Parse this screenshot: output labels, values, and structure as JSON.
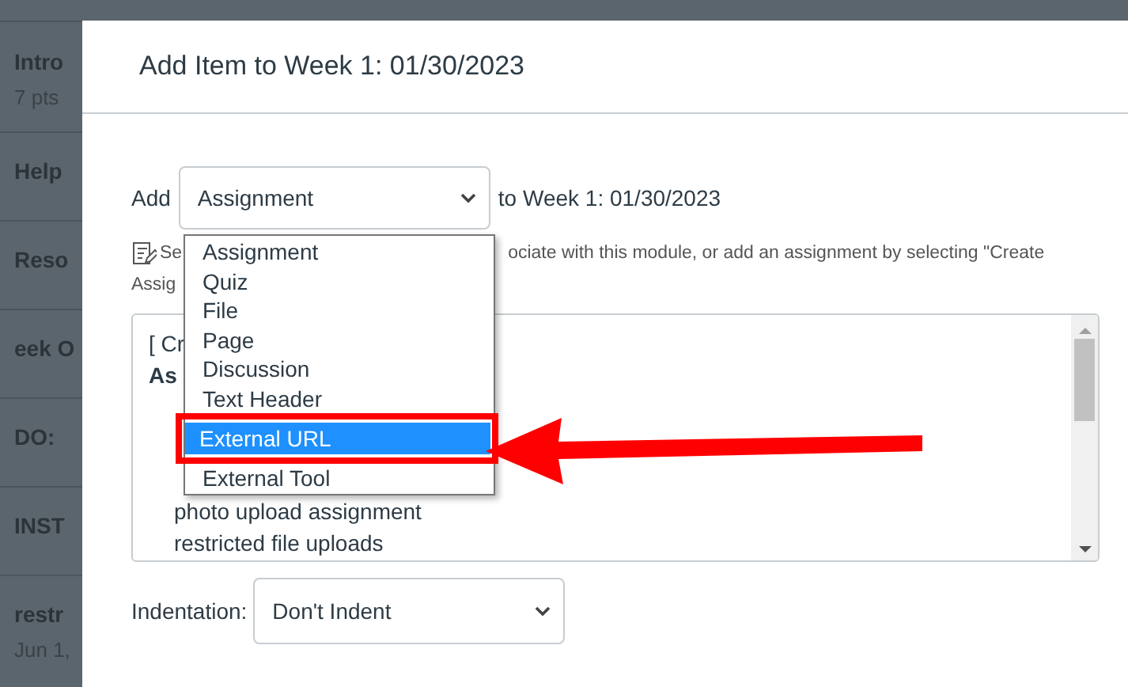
{
  "background_list": [
    {
      "title": "Intro",
      "meta": "7 pts"
    },
    {
      "title": "Help"
    },
    {
      "title": "Reso"
    },
    {
      "title": "eek O"
    },
    {
      "title": "DO:"
    },
    {
      "title": "INST"
    },
    {
      "title": "restr",
      "meta": "Jun 1,"
    }
  ],
  "modal": {
    "title": "Add Item to Week 1: 01/30/2023",
    "add_label": "Add",
    "type_select": "Assignment",
    "target": "to Week 1: 01/30/2023",
    "help_lines": [
      [
        "Se",
        "ociate with this module, or add an assignment by selecting \"Create"
      ],
      [
        "Assig"
      ]
    ],
    "item_list": [
      {
        "text": "[ Cr",
        "kind": "plain"
      },
      {
        "text": "As",
        "kind": "group"
      },
      {
        "kind": "covered"
      },
      {
        "kind": "covered"
      },
      {
        "kind": "covered"
      },
      {
        "text": "photo upload assignment",
        "kind": "item"
      },
      {
        "text": "restricted file uploads",
        "kind": "item"
      }
    ],
    "type_options": [
      {
        "label": "Assignment",
        "selected": false
      },
      {
        "label": "Quiz",
        "selected": false
      },
      {
        "label": "File",
        "selected": false
      },
      {
        "label": "Page",
        "selected": false
      },
      {
        "label": "Discussion",
        "selected": false
      },
      {
        "label": "Text Header",
        "selected": false
      },
      {
        "label": "External URL",
        "selected": true
      },
      {
        "label": "External Tool",
        "selected": false
      }
    ],
    "indentation_label": "Indentation:",
    "indentation_select": "Don't Indent"
  }
}
